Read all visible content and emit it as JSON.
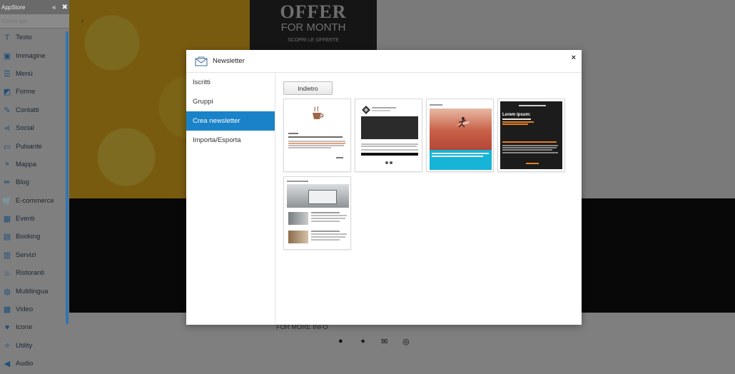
{
  "sidebar": {
    "title": "AppStore",
    "search_placeholder": "Cerca qui...",
    "items": [
      {
        "label": "Testo",
        "icon": "text-icon"
      },
      {
        "label": "Immagine",
        "icon": "image-icon"
      },
      {
        "label": "Menù",
        "icon": "menu-icon"
      },
      {
        "label": "Forme",
        "icon": "shapes-icon"
      },
      {
        "label": "Contatti",
        "icon": "contacts-icon"
      },
      {
        "label": "Social",
        "icon": "share-icon"
      },
      {
        "label": "Pulsante",
        "icon": "button-icon"
      },
      {
        "label": "Mappa",
        "icon": "map-pin-icon"
      },
      {
        "label": "Blog",
        "icon": "pencil-icon"
      },
      {
        "label": "E-commerce",
        "icon": "cart-icon"
      },
      {
        "label": "Eventi",
        "icon": "calendar-icon"
      },
      {
        "label": "Booking",
        "icon": "booking-icon"
      },
      {
        "label": "Servizi",
        "icon": "services-icon"
      },
      {
        "label": "Ristoranti",
        "icon": "restaurant-icon"
      },
      {
        "label": "Multilingua",
        "icon": "globe-icon"
      },
      {
        "label": "Video",
        "icon": "film-icon"
      },
      {
        "label": "Icone",
        "icon": "heart-icon"
      },
      {
        "label": "Utility",
        "icon": "wrench-icon"
      },
      {
        "label": "Audio",
        "icon": "speaker-icon"
      }
    ]
  },
  "background": {
    "offer_big": "OFFER",
    "offer_small": "FOR MONTH",
    "offer_tiny": "SCOPRI LE OFFERTE",
    "footer_text": "FOR MORE INFO"
  },
  "modal": {
    "title": "Newsletter",
    "close": "×",
    "nav": [
      {
        "label": "Iscritti",
        "active": false
      },
      {
        "label": "Gruppi",
        "active": false
      },
      {
        "label": "Crea newsletter",
        "active": true
      },
      {
        "label": "Importa/Esporta",
        "active": false
      }
    ],
    "back_label": "Indietro",
    "templates": [
      {
        "name": "template-coffee"
      },
      {
        "name": "template-clock"
      },
      {
        "name": "template-surfer"
      },
      {
        "name": "template-dark"
      },
      {
        "name": "template-interior"
      }
    ],
    "tpl4_heading": "Lorem ipsum:"
  },
  "colors": {
    "accent": "#1a82c8",
    "sidebar_bg": "#7f7f7f",
    "overlay": "rgba(0,0,0,0.5)"
  }
}
